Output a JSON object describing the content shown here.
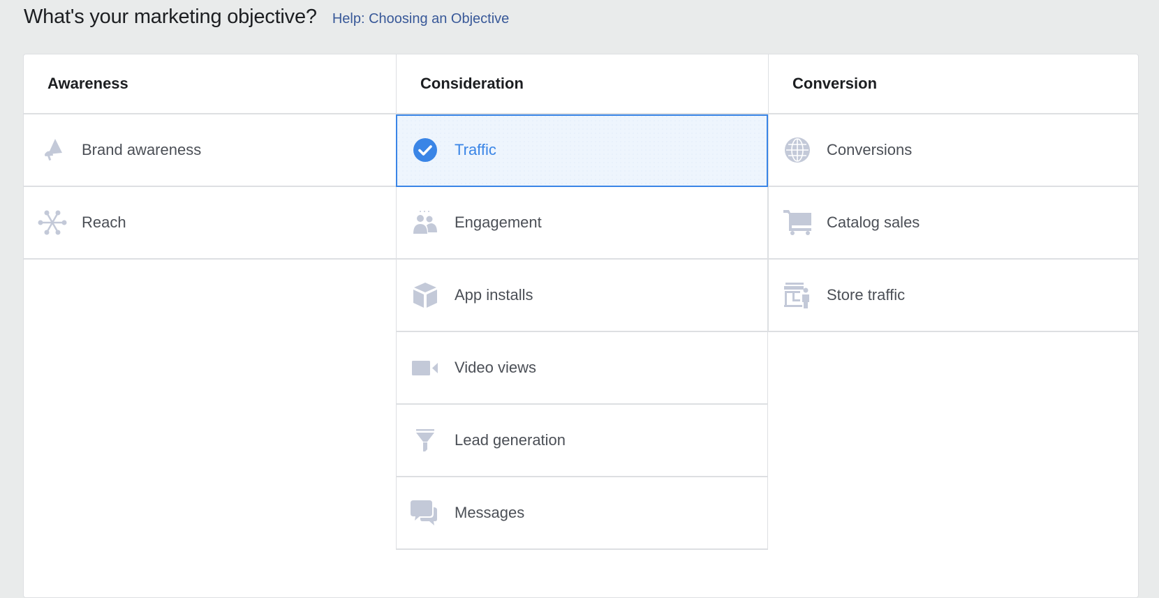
{
  "header": {
    "title": "What's your marketing objective?",
    "help_link": "Help: Choosing an Objective"
  },
  "colors": {
    "accent": "#3a85e6",
    "icon_gray": "#c3c9d8",
    "link": "#385898",
    "selected_bg": "#eef5fd"
  },
  "columns": [
    {
      "title": "Awareness",
      "items": [
        {
          "label": "Brand awareness",
          "icon": "megaphone-icon",
          "selected": false
        },
        {
          "label": "Reach",
          "icon": "network-icon",
          "selected": false
        }
      ]
    },
    {
      "title": "Consideration",
      "items": [
        {
          "label": "Traffic",
          "icon": "check-circle-icon",
          "selected": true
        },
        {
          "label": "Engagement",
          "icon": "people-icon",
          "selected": false
        },
        {
          "label": "App installs",
          "icon": "cube-icon",
          "selected": false
        },
        {
          "label": "Video views",
          "icon": "video-camera-icon",
          "selected": false
        },
        {
          "label": "Lead generation",
          "icon": "funnel-icon",
          "selected": false
        },
        {
          "label": "Messages",
          "icon": "chat-bubbles-icon",
          "selected": false
        }
      ]
    },
    {
      "title": "Conversion",
      "items": [
        {
          "label": "Conversions",
          "icon": "globe-icon",
          "selected": false
        },
        {
          "label": "Catalog sales",
          "icon": "shopping-cart-icon",
          "selected": false
        },
        {
          "label": "Store traffic",
          "icon": "storefront-icon",
          "selected": false
        }
      ]
    }
  ]
}
